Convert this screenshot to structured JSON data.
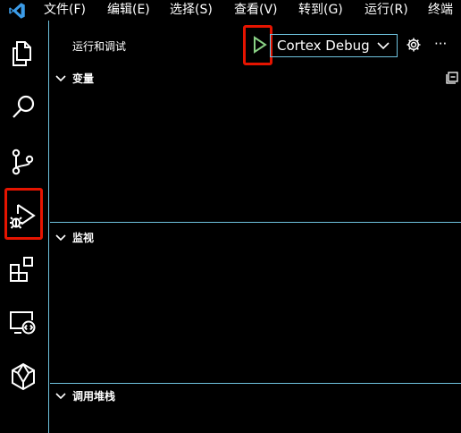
{
  "menubar": {
    "items": [
      "文件(F)",
      "编辑(E)",
      "选择(S)",
      "查看(V)",
      "转到(G)",
      "运行(R)",
      "终端"
    ]
  },
  "activity": {
    "icons": [
      "explorer-icon",
      "search-icon",
      "source-control-icon",
      "run-debug-icon",
      "extensions-icon",
      "remote-explorer-icon",
      "cortex-icon"
    ]
  },
  "sidebar": {
    "title": "运行和调试",
    "config": "Cortex Debug",
    "more": "···",
    "sections": {
      "variables": "变量",
      "watch": "监视",
      "callstack": "调用堆栈"
    }
  },
  "colors": {
    "highlight": "#e51400",
    "border": "#6fc3df",
    "play": "#89d185",
    "vscode_blue": "#3c9ce8"
  }
}
